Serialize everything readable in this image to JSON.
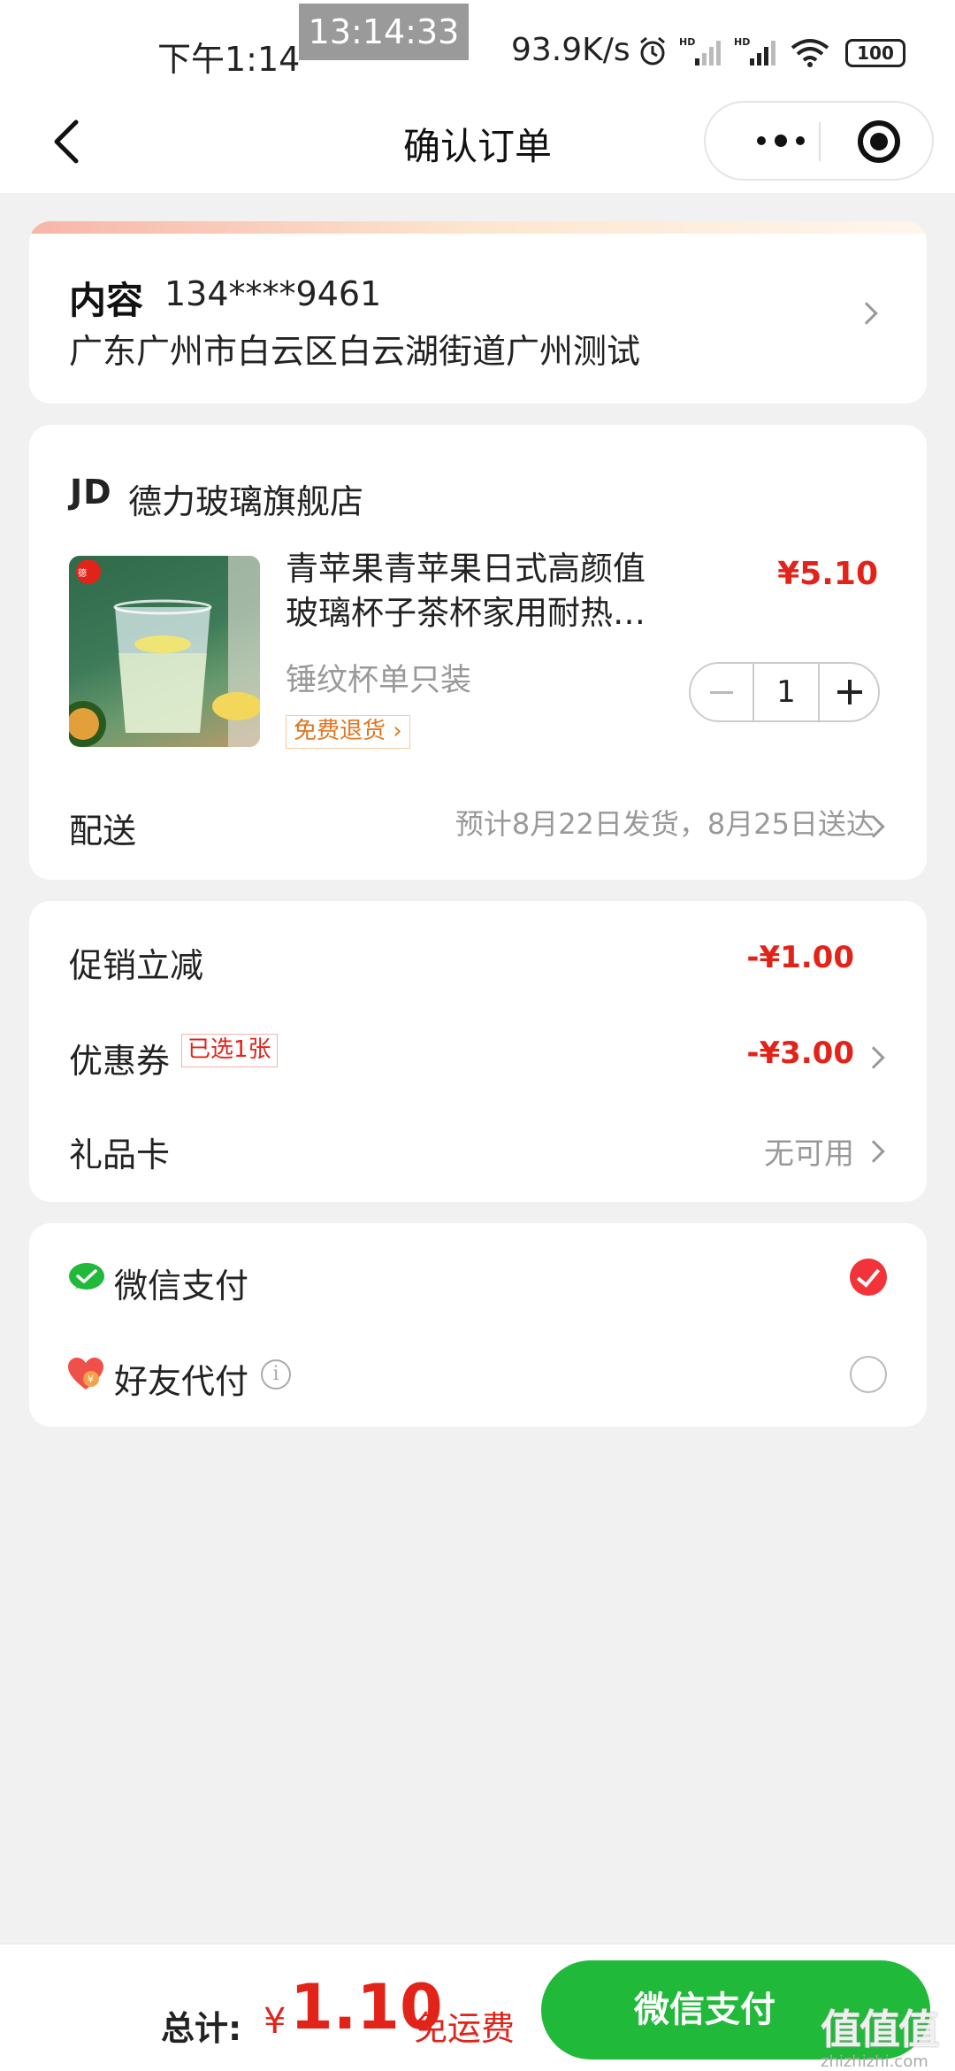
{
  "status_bar": {
    "time": "下午1:14",
    "clock_badge": "13:14:33",
    "network_speed": "93.9K/s",
    "battery": "100"
  },
  "nav": {
    "title": "确认订单"
  },
  "address": {
    "name": "内容",
    "phone": "134****9461",
    "detail": "广东广州市白云区白云湖街道广州测试"
  },
  "shop": {
    "logo": "JD",
    "name": "德力玻璃旗舰店",
    "product": {
      "title": "青苹果青苹果日式高颜值玻璃杯子茶杯家用耐热…",
      "spec": "锤纹杯单只装",
      "badge": "免费退货 ›",
      "price": "¥5.10",
      "quantity": "1"
    },
    "delivery": {
      "label": "配送",
      "value": "预计8月22日发货，8月25日送达"
    }
  },
  "discounts": {
    "promo": {
      "label": "促销立减",
      "value": "-¥1.00"
    },
    "coupon": {
      "label": "优惠券",
      "tag": "已选1张",
      "value": "-¥3.00"
    },
    "gift_card": {
      "label": "礼品卡",
      "value": "无可用"
    }
  },
  "payment": {
    "options": [
      {
        "label": "微信支付",
        "selected": true
      },
      {
        "label": "好友代付",
        "selected": false
      }
    ],
    "info_glyph": "i"
  },
  "footer": {
    "total_label": "总计:",
    "currency": "¥",
    "total_amount": "1.10",
    "shipping_note": "免运费",
    "pay_button": "微信支付",
    "watermark_logo": "值值值",
    "watermark_url": "zhizhizhi.com"
  },
  "colors": {
    "accent_red": "#e2231a",
    "wechat_green": "#21b93a",
    "badge_orange": "#e0761f"
  }
}
